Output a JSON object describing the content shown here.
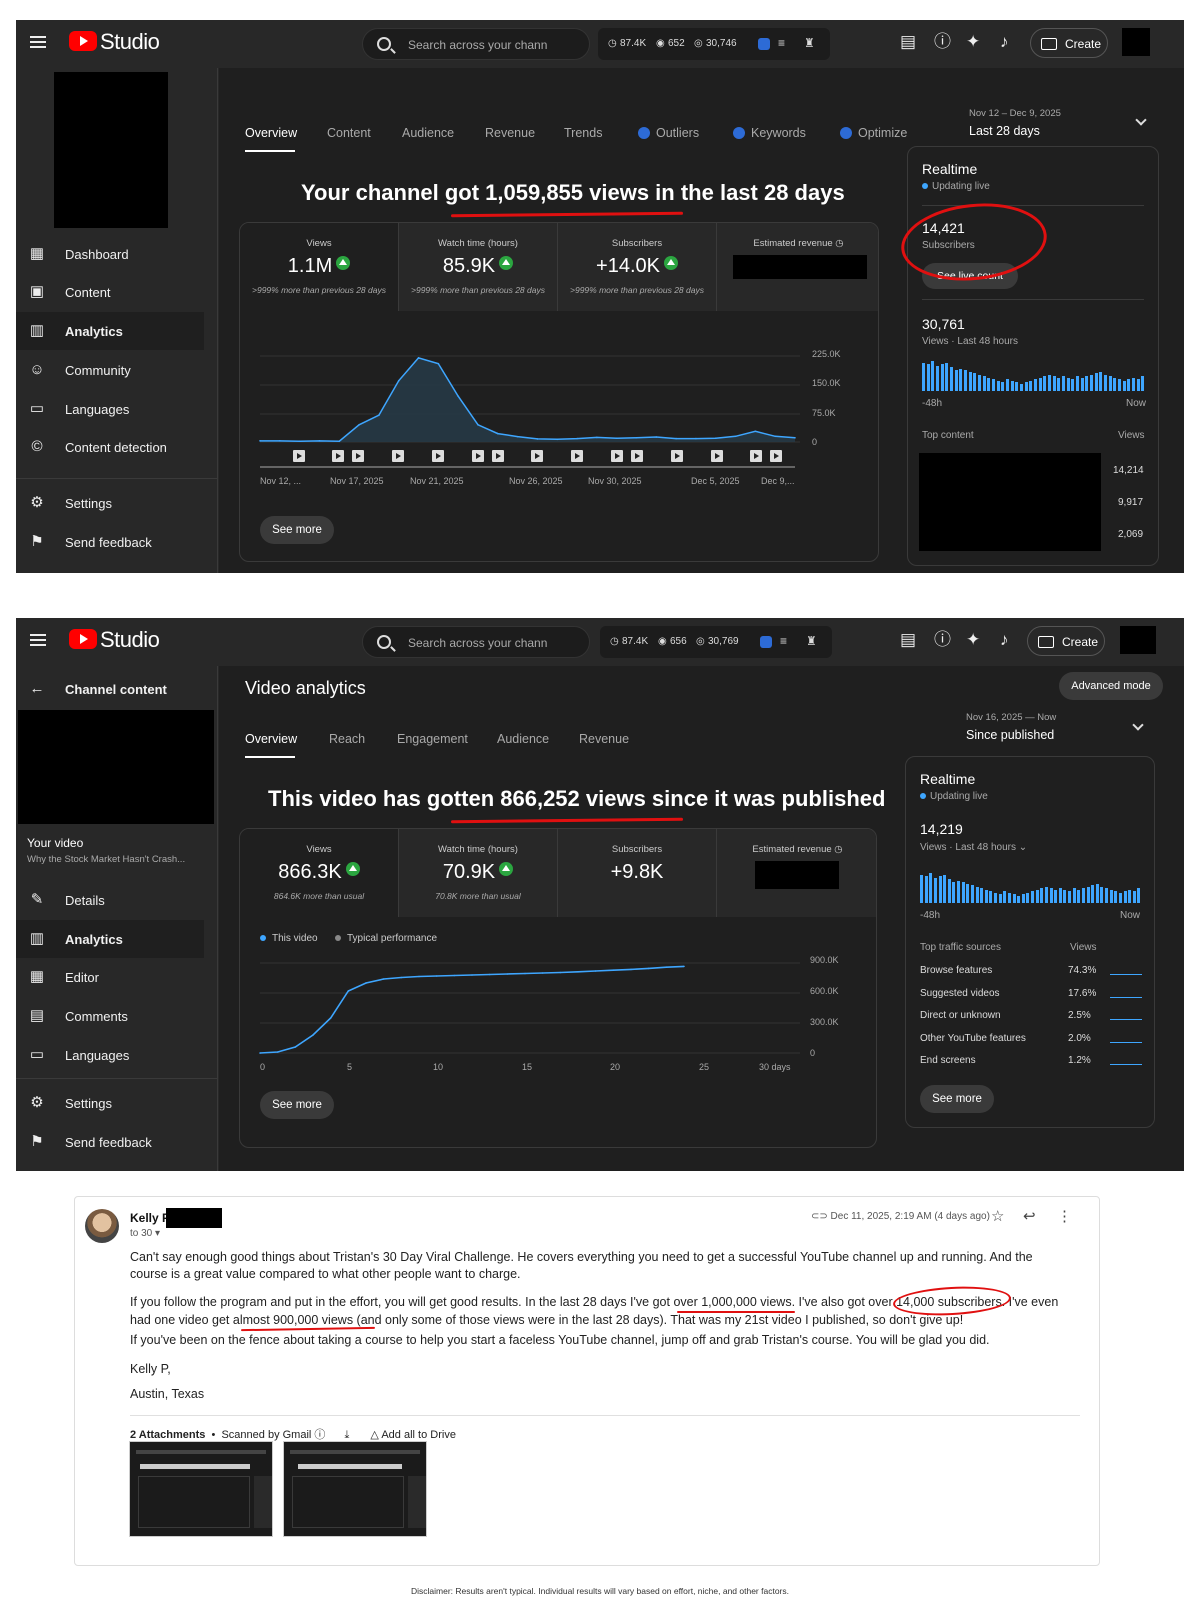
{
  "top_panel": {
    "app": "Studio",
    "search_placeholder": "Search across your chann",
    "stats": [
      "87.4K",
      "652",
      "30,746"
    ],
    "create_label": "Create",
    "nav": [
      {
        "label": "Dashboard",
        "icon": "dashboard-icon"
      },
      {
        "label": "Content",
        "icon": "content-icon"
      },
      {
        "label": "Analytics",
        "icon": "analytics-icon"
      },
      {
        "label": "Community",
        "icon": "community-icon"
      },
      {
        "label": "Languages",
        "icon": "languages-icon"
      },
      {
        "label": "Content detection",
        "icon": "copyright-icon"
      },
      {
        "label": "Settings",
        "icon": "gear-icon"
      },
      {
        "label": "Send feedback",
        "icon": "feedback-icon"
      }
    ],
    "tabs": [
      "Overview",
      "Content",
      "Audience",
      "Revenue",
      "Trends",
      "Outliers",
      "Keywords",
      "Optimize"
    ],
    "date_range": "Nov 12 – Dec 9, 2025",
    "date_label": "Last 28 days",
    "headline": "Your channel got 1,059,855 views in the last 28 days",
    "metrics": [
      {
        "label": "Views",
        "value": "1.1M",
        "sub": ">999% more than previous 28 days"
      },
      {
        "label": "Watch time (hours)",
        "value": "85.9K",
        "sub": ">999% more than previous 28 days"
      },
      {
        "label": "Subscribers",
        "value": "+14.0K",
        "sub": ">999% more than previous 28 days"
      },
      {
        "label": "Estimated revenue",
        "value": "",
        "sub": ""
      }
    ],
    "y_ticks": [
      "225.0K",
      "150.0K",
      "75.0K",
      "0"
    ],
    "x_ticks": [
      "Nov 12, ...",
      "Nov 17, 2025",
      "Nov 21, 2025",
      "Nov 26, 2025",
      "Nov 30, 2025",
      "Dec 5, 2025",
      "Dec 9,..."
    ],
    "see_more": "See more",
    "realtime": {
      "title": "Realtime",
      "live": "Updating live",
      "subscribers": "14,421",
      "subscribers_label": "Subscribers",
      "live_count_btn": "See live count",
      "views": "30,761",
      "views_label": "Views · Last 48 hours",
      "left": "-48h",
      "right": "Now",
      "top_content": "Top content",
      "views_col": "Views",
      "top_values": [
        "14,214",
        "9,917",
        "2,069"
      ]
    }
  },
  "bottom_panel": {
    "app": "Studio",
    "search_placeholder": "Search across your chann",
    "stats": [
      "87.4K",
      "656",
      "30,769"
    ],
    "create_label": "Create",
    "back_label": "Channel content",
    "your_video": "Your video",
    "video_title": "Why the Stock Market Hasn't Crash...",
    "nav": [
      {
        "label": "Details",
        "icon": "pencil-icon"
      },
      {
        "label": "Analytics",
        "icon": "analytics-icon"
      },
      {
        "label": "Editor",
        "icon": "editor-icon"
      },
      {
        "label": "Comments",
        "icon": "comments-icon"
      },
      {
        "label": "Languages",
        "icon": "languages-icon"
      },
      {
        "label": "Settings",
        "icon": "gear-icon"
      },
      {
        "label": "Send feedback",
        "icon": "feedback-icon"
      }
    ],
    "page_title": "Video analytics",
    "advanced_mode": "Advanced mode",
    "tabs": [
      "Overview",
      "Reach",
      "Engagement",
      "Audience",
      "Revenue"
    ],
    "date_range": "Nov 16, 2025 — Now",
    "date_label": "Since published",
    "headline": "This video has gotten 866,252 views since it was published",
    "metrics": [
      {
        "label": "Views",
        "value": "866.3K",
        "sub": "864.6K more than usual"
      },
      {
        "label": "Watch time (hours)",
        "value": "70.9K",
        "sub": "70.8K more than usual"
      },
      {
        "label": "Subscribers",
        "value": "+9.8K",
        "sub": ""
      },
      {
        "label": "Estimated revenue",
        "value": "",
        "sub": ""
      }
    ],
    "legend": [
      "This video",
      "Typical performance"
    ],
    "y_ticks": [
      "900.0K",
      "600.0K",
      "300.0K",
      "0"
    ],
    "x_ticks": [
      "0",
      "5",
      "10",
      "15",
      "20",
      "25",
      "30 days"
    ],
    "see_more": "See more",
    "realtime": {
      "title": "Realtime",
      "live": "Updating live",
      "views": "14,219",
      "views_label": "Views · Last 48 hours",
      "left": "-48h",
      "right": "Now",
      "traffic_title": "Top traffic sources",
      "views_col": "Views",
      "traffic": [
        {
          "name": "Browse features",
          "pct": "74.3%"
        },
        {
          "name": "Suggested videos",
          "pct": "17.6%"
        },
        {
          "name": "Direct or unknown",
          "pct": "2.5%"
        },
        {
          "name": "Other YouTube features",
          "pct": "2.0%"
        },
        {
          "name": "End screens",
          "pct": "1.2%"
        }
      ],
      "see_more": "See more"
    }
  },
  "email": {
    "sender": "Kelly P",
    "to": "to 30",
    "date": "Dec 11, 2025, 2:19 AM (4 days ago)",
    "p1": "Can't say enough good things about Tristan's 30 Day Viral Challenge. He covers everything you need to get a successful YouTube channel up and running. And the course is a great value compared to what other people want to charge.",
    "p2": "If you follow the program and put in the effort, you will get good results. In the last 28 days I've got over 1,000,000 views. I've also got over 14,000 subscribers. I've even had one video get almost 900,000 views (and only some of those views were in the last 28 days). That was my 21st video I published, so don't give up!",
    "p3": "If you've been on the fence about taking a course to help you start a faceless YouTube channel, jump off and grab Tristan's course. You will be glad you did.",
    "sign1": "Kelly P,",
    "sign2": "Austin, Texas",
    "attachments": "2 Attachments",
    "scanned": "Scanned by Gmail",
    "add_drive": "Add all to Drive"
  },
  "disclaimer": "Disclaimer: Results aren't typical. Individual results will vary based on effort, niche, and other factors.",
  "chart_data": [
    {
      "type": "line",
      "x": [
        "Nov 12",
        "Nov 13",
        "Nov 14",
        "Nov 15",
        "Nov 16",
        "Nov 17",
        "Nov 18",
        "Nov 19",
        "Nov 20",
        "Nov 21",
        "Nov 22",
        "Nov 23",
        "Nov 24",
        "Nov 25",
        "Nov 26",
        "Nov 27",
        "Nov 28",
        "Nov 29",
        "Nov 30",
        "Dec 1",
        "Dec 2",
        "Dec 3",
        "Dec 4",
        "Dec 5",
        "Dec 6",
        "Dec 7",
        "Dec 8",
        "Dec 9"
      ],
      "values": [
        3000,
        3000,
        2000,
        3000,
        2000,
        45000,
        70000,
        160000,
        220000,
        205000,
        120000,
        45000,
        22000,
        14000,
        8000,
        7000,
        9000,
        12000,
        10000,
        11000,
        13000,
        9000,
        9000,
        10000,
        15000,
        28000,
        15000,
        11000
      ],
      "ylim": [
        0,
        225000
      ],
      "ylabel": "",
      "xlabel": ""
    },
    {
      "type": "line",
      "x": [
        0,
        1,
        2,
        3,
        4,
        5,
        6,
        7,
        8,
        9,
        10,
        11,
        12,
        13,
        14,
        15,
        16,
        17,
        18,
        19,
        20,
        21,
        22,
        23,
        24
      ],
      "values": [
        0,
        10000,
        60000,
        180000,
        350000,
        620000,
        700000,
        740000,
        755000,
        765000,
        770000,
        775000,
        780000,
        785000,
        790000,
        795000,
        800000,
        805000,
        812000,
        820000,
        828000,
        836000,
        846000,
        858000,
        866252
      ],
      "ylim": [
        0,
        900000
      ],
      "ylabel": "",
      "xlabel": "",
      "series_name": "This video"
    }
  ]
}
